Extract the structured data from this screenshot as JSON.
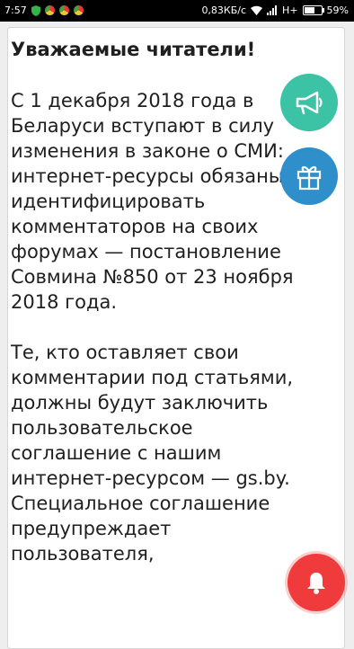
{
  "status_bar": {
    "time": "7:57",
    "network_speed": "0,83КБ/с",
    "network_type": "H+",
    "battery": "59%",
    "battery_level": 0.59,
    "icons": [
      "shield-icon",
      "chrome-icon",
      "chrome-icon",
      "chrome-icon",
      "wifi-icon",
      "signal-icon",
      "battery-icon"
    ]
  },
  "article": {
    "heading": "Уважаемые читатели!",
    "paragraphs": [
      "С 1 декабря 2018 года в Беларуси вступают в силу изменения в законе о СМИ: интернет-ресурсы обязаны идентифицировать комментаторов на своих форумах — постановление Совмина №850 от 23 ноября 2018 года.",
      "Те, кто оставляет свои комментарии под статьями, должны будут заключить пользовательское соглашение с нашим интернет-ресурсом — gs.by. Специальное соглашение предупреждает пользователя,"
    ]
  },
  "floating_buttons": {
    "megaphone": {
      "icon": "megaphone-icon",
      "color": "#3cc3a6"
    },
    "gift": {
      "icon": "gift-icon",
      "color": "#2f8fcb"
    },
    "notifications": {
      "icon": "bell-icon",
      "color": "#ef3b3b"
    }
  }
}
